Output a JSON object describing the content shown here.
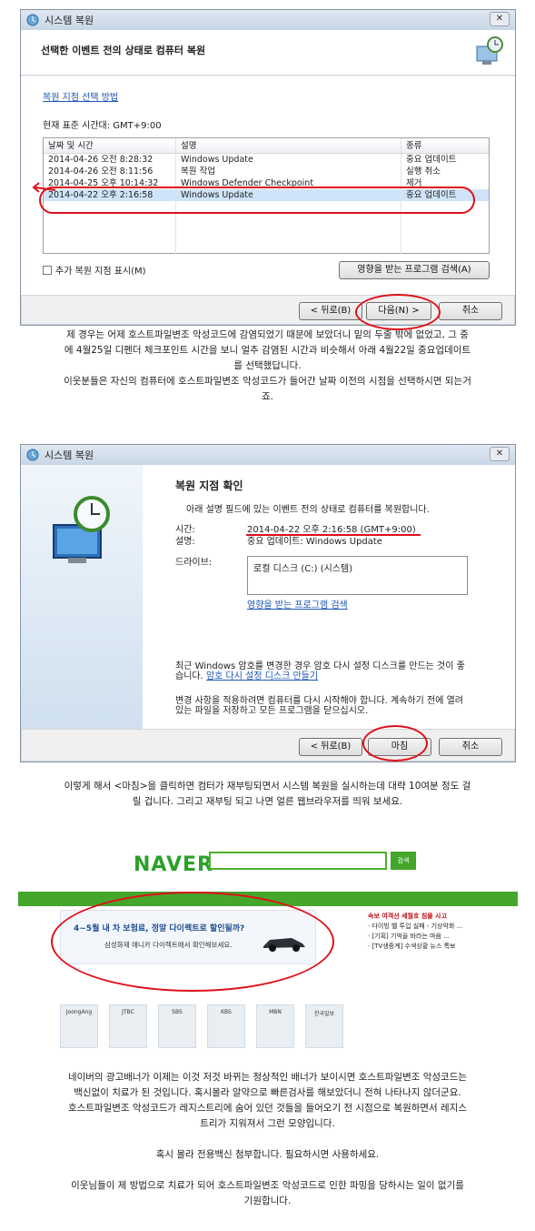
{
  "dialog1": {
    "title": "시스템 복원",
    "heading": "선택한 이벤트 전의 상태로 컴퓨터 복원",
    "help_link": "복원 지점 선택 방법",
    "timezone": "현재 표준 시간대: GMT+9:00",
    "columns": [
      "날짜 및 시간",
      "설명",
      "종류"
    ],
    "rows": [
      {
        "date": "2014-04-26 오전 8:28:32",
        "desc": "Windows Update",
        "type": "중요 업데이트"
      },
      {
        "date": "2014-04-26 오전 8:11:56",
        "desc": "복원 작업",
        "type": "실행 취소"
      },
      {
        "date": "2014-04-25 오후 10:14:32",
        "desc": "Windows Defender Checkpoint",
        "type": "제거"
      },
      {
        "date": "2014-04-22 오후 2:16:58",
        "desc": "Windows Update",
        "type": "중요 업데이트"
      }
    ],
    "show_more": "추가 복원 지점 표시(M)",
    "scan_button": "영향을 받는 프로그램 검색(A)",
    "back_button": "< 뒤로(B)",
    "next_button": "다음(N) >",
    "cancel_button": "취소"
  },
  "caption1": [
    "제 경우는 어제 호스트파일변조 악성코드에 감염되었기 때문에 보았더니 밑의 두줄 밖에 없었고, 그 중",
    "에 4월25일 디펜더 체크포인트 시간을 보니 얼추 감염된 시간과 비슷해서 아래 4월22일 중요업데이트",
    "를 선택했답니다.",
    "이웃분들은 자신의 컴퓨터에 호스트파일변조 악성코드가 들어간 날짜 이전의 시점을 선택하시면 되는거",
    "죠."
  ],
  "dialog2": {
    "title": "시스템 복원",
    "heading": "복원 지점 확인",
    "subtitle": "아래 설명 필드에 있는 이벤트 전의 상태로 컴퓨터를 복원합니다.",
    "time_label": "시간:",
    "time_value": "2014-04-22 오후 2:16:58 (GMT+9:00)",
    "desc_label": "설명:",
    "desc_value": "중요 업데이트: Windows Update",
    "drive_label": "드라이브:",
    "drive_value": "로컬 디스크 (C:) (시스템)",
    "scan_link": "영향을 받는 프로그램 검색",
    "password_text_1": "최근 Windows 암호를 변경한 경우 암호 다시 설정 디스크를 만드는 것이 좋",
    "password_text_2": "습니다.",
    "password_link": "암호 다시 설정 디스크 만들기",
    "save_text_1": "변경 사항을 적용하려면 컴퓨터를 다시 시작해야 합니다. 계속하기 전에 열려",
    "save_text_2": "있는 파일을 저장하고 모든 프로그램을 닫으십시오.",
    "back_button": "< 뒤로(B)",
    "finish_button": "마침",
    "cancel_button": "취소"
  },
  "caption2": [
    "이렇게 해서 <마침>을 클릭하면 컴터가 재부팅되면서 시스템 복원을 실시하는데 대략 10여분 정도 걸",
    "릴 겁니다.    그리고 재부팅 되고 나면 얼른 웹브라우저를 띄워 보세요."
  ],
  "naver": {
    "logo": "NAVER",
    "search_button": "검색",
    "banner_line1": "4~5월 내 차 보험료, 정말 다이렉트로 할인될까?",
    "banner_line2": "삼성화재 애니카 다이렉트에서 확인해보세요.",
    "news_items": [
      "속보  여객선 세월호 침몰 사고",
      "· 다이빙 벨 투입 실패 - 기상악화 ...",
      "· [기획] 기억을 바라는 마음 ...",
      "· [TV생중계] 수색상황 뉴스 특보"
    ],
    "thumbs": [
      "JoongAng",
      "JTBC",
      "SBS",
      "KBS",
      "MBN",
      "한국일보"
    ]
  },
  "caption3": [
    "네이버의 광고배너가 이제는 이것 저것 바뀌는 정상적인 배너가 보이시면 호스트파일변조 악성코드는",
    "백신없이 치료가 된 것입니다.    혹시몰라 알약으로 빠른검사를 해보았더니 전혀 나타나지 않더군요.",
    "호스트파일변조 악성코드가 레지스트리에 숨어 있던 것들을 들어오기 전 시점으로 복원하면서 레지스",
    "트리가 지워져서 그런 모양입니다.",
    "",
    "혹시 몰라 전용백신 첨부합니다.    필요하시면 사용하세요.",
    "",
    "이웃님들이 제 방법으로 치료가 되어 호스트파일변조 악성코드로 인한 파밍을 당하시는 일이 없기를",
    "기원합니다."
  ],
  "colors": {
    "highlight_circle": "#e0101a",
    "naver_green": "#44a62a",
    "link": "#1a55b5"
  }
}
